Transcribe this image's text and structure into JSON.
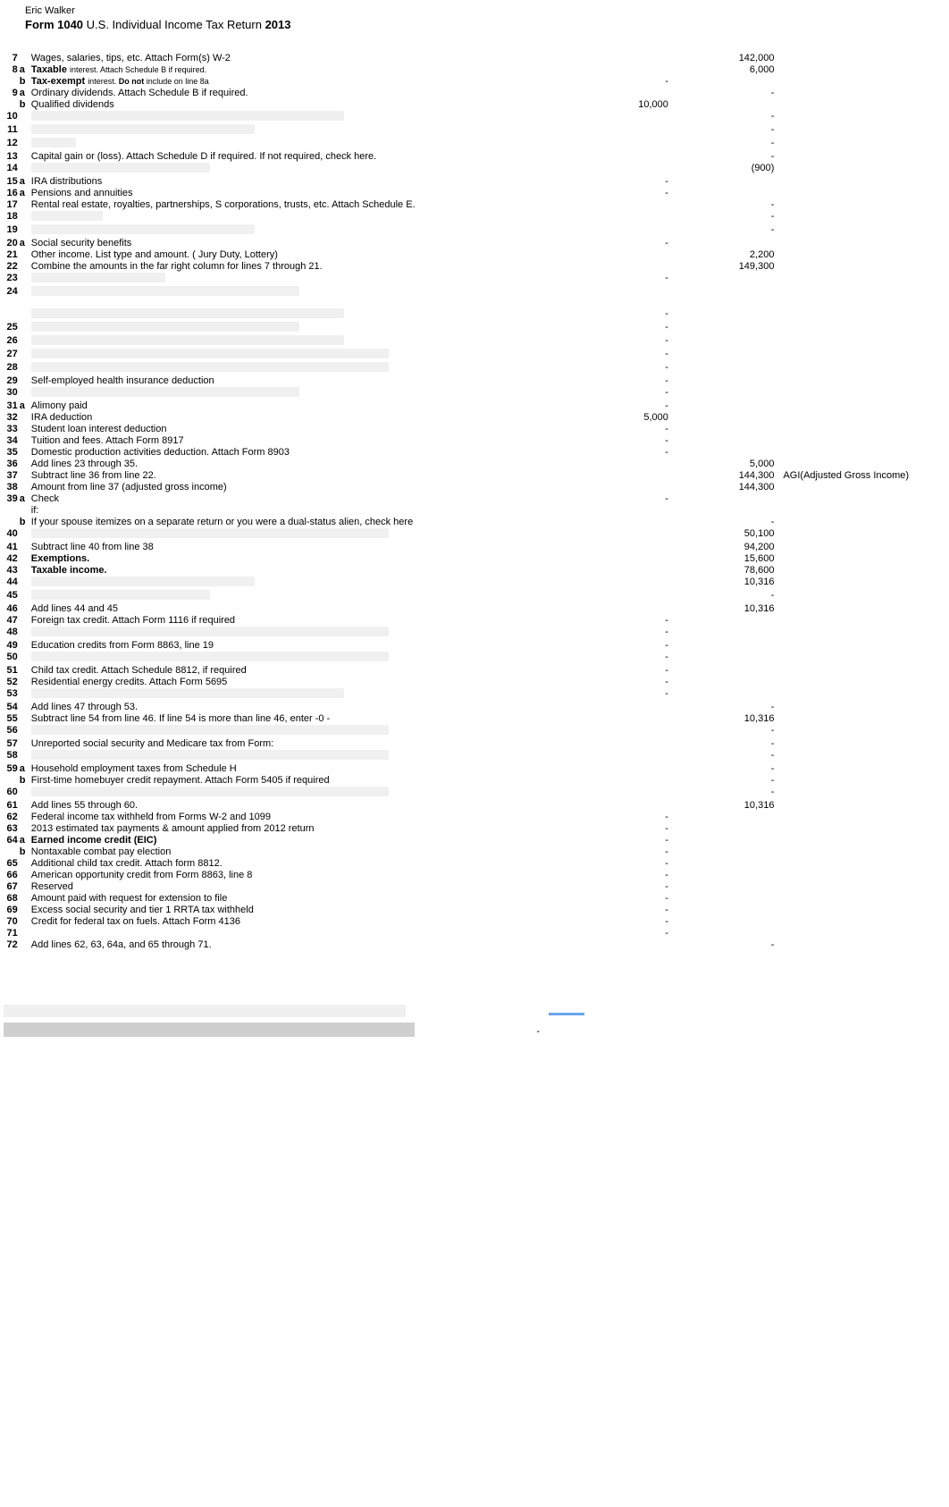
{
  "header": {
    "name": "Eric Walker",
    "form_label_bold": "Form 1040",
    "form_label_rest": " U.S. Individual Income Tax Return ",
    "year": "2013"
  },
  "lines": [
    {
      "n": "7",
      "s": "",
      "desc": "Wages, salaries, tips, etc. Attach Form(s) W-2",
      "col1": "",
      "col2": "142,000"
    },
    {
      "n": "8",
      "s": "a",
      "desc_html": "<span class='bold'>Taxable</span> <span class='sm'>interest.  Attach Schedule B if required.</span>",
      "col1": "",
      "col2": "6,000"
    },
    {
      "n": "",
      "s": "b",
      "desc_html": "<span class='bold'>Tax-exempt</span> <span class='sm'>interest.  <span class='bold'>Do not</span> include on line 8a</span>",
      "col1": "-",
      "col2": ""
    },
    {
      "n": "9",
      "s": "a",
      "desc": "Ordinary dividends.  Attach Schedule B if required.",
      "col1": "",
      "col2": "-"
    },
    {
      "n": "",
      "s": "b",
      "desc": "Qualified dividends",
      "col1": "10,000",
      "col2": ""
    },
    {
      "n": "10",
      "s": "",
      "redact": "w350",
      "col1": "",
      "col2": "-"
    },
    {
      "n": "11",
      "s": "",
      "redact": "w250",
      "col1": "",
      "col2": "-"
    },
    {
      "n": "12",
      "s": "",
      "redact": "w50",
      "col1": "",
      "col2": "-"
    },
    {
      "n": "13",
      "s": "",
      "desc": "Capital gain or (loss). Attach Schedule D if required. If not required, check here.",
      "col1": "",
      "col2": "-"
    },
    {
      "n": "14",
      "s": "",
      "redact": "w200",
      "col1": "",
      "col2": "(900)"
    },
    {
      "n": "15",
      "s": "a",
      "desc": "IRA distributions",
      "col1": "-",
      "col2": ""
    },
    {
      "n": "16",
      "s": "a",
      "desc": "Pensions and annuities",
      "col1": "-",
      "col2": ""
    },
    {
      "n": "17",
      "s": "",
      "desc": "Rental real estate, royalties, partnerships, S corporations, trusts, etc.     Attach Schedule E.",
      "col1": "",
      "col2": "-"
    },
    {
      "n": "18",
      "s": "",
      "redact": "w80",
      "col1": "",
      "col2": "-"
    },
    {
      "n": "19",
      "s": "",
      "redact": "w250",
      "col1": "",
      "col2": "-"
    },
    {
      "n": "20",
      "s": "a",
      "desc": "Social security benefits",
      "col1": "-",
      "col2": ""
    },
    {
      "n": "21",
      "s": "",
      "desc": "Other income.  List type and amount. ( Jury Duty, Lottery)",
      "col1": "",
      "col2": "2,200"
    },
    {
      "n": "22",
      "s": "",
      "desc": "Combine the amounts in the far right column for lines 7 through 21.",
      "col1": "",
      "col2": "149,300"
    },
    {
      "n": "23",
      "s": "",
      "redact": "w150",
      "col1": "-",
      "col2": ""
    },
    {
      "n": "24",
      "s": "",
      "redact": "w300",
      "col1": "",
      "col2": ""
    },
    {
      "spacer": true
    },
    {
      "n": "",
      "s": "",
      "redact": "w350",
      "col1": "-",
      "col2": ""
    },
    {
      "n": "25",
      "s": "",
      "redact": "w300",
      "col1": "-",
      "col2": ""
    },
    {
      "n": "26",
      "s": "",
      "redact": "w350",
      "col1": "-",
      "col2": ""
    },
    {
      "n": "27",
      "s": "",
      "redact": "w400",
      "col1": "-",
      "col2": ""
    },
    {
      "n": "28",
      "s": "",
      "redact": "w400",
      "col1": "-",
      "col2": ""
    },
    {
      "n": "29",
      "s": "",
      "desc": "Self-employed health insurance deduction",
      "col1": "-",
      "col2": ""
    },
    {
      "n": "30",
      "s": "",
      "redact": "w300",
      "col1": "-",
      "col2": ""
    },
    {
      "n": "31",
      "s": "a",
      "desc": "Alimony paid",
      "col1": "-",
      "col2": ""
    },
    {
      "n": "32",
      "s": "",
      "desc": "IRA deduction",
      "col1": "5,000",
      "col2": ""
    },
    {
      "n": "33",
      "s": "",
      "desc": "Student loan interest deduction",
      "col1": "-",
      "col2": ""
    },
    {
      "n": "34",
      "s": "",
      "desc": "Tuition and fees. Attach Form 8917",
      "col1": "-",
      "col2": ""
    },
    {
      "n": "35",
      "s": "",
      "desc": "Domestic production activities deduction.  Attach Form 8903",
      "col1": "-",
      "col2": ""
    },
    {
      "n": "36",
      "s": "",
      "desc": "Add lines  23  through 35.",
      "col1": "",
      "col2": "5,000"
    },
    {
      "n": "37",
      "s": "",
      "desc": "Subtract line 36 from line 22.",
      "col1": "",
      "col2": "144,300",
      "side": "AGI(Adjusted Gross Income)"
    },
    {
      "n": "38",
      "s": "",
      "desc": "Amount from line 37 (adjusted gross income)",
      "col1": "",
      "col2": "144,300"
    },
    {
      "n": "39",
      "s": "a",
      "desc": "Check",
      "col1": "-",
      "col2": ""
    },
    {
      "n": "",
      "s": "",
      "desc": "if:",
      "col1": "",
      "col2": ""
    },
    {
      "n": "",
      "s": "b",
      "desc": "If your spouse itemizes on a separate return or you were a dual-status alien, check here",
      "col1": "",
      "col2": "-"
    },
    {
      "n": "40",
      "s": "",
      "redact": "w400",
      "col1": "",
      "col2": "50,100"
    },
    {
      "n": "41",
      "s": "",
      "desc": "Subtract line 40 from line 38",
      "col1": "",
      "col2": "94,200"
    },
    {
      "n": "42",
      "s": "",
      "desc_html": "<span class='bold'>Exemptions.</span>",
      "col1": "",
      "col2": "15,600"
    },
    {
      "n": "43",
      "s": "",
      "desc_html": "<span class='bold'>Taxable income.</span>",
      "col1": "",
      "col2": "78,600"
    },
    {
      "n": "44",
      "s": "",
      "redact": "w250",
      "col1": "",
      "col2": "10,316"
    },
    {
      "n": "45",
      "s": "",
      "redact": "w200",
      "col1": "",
      "col2": "-"
    },
    {
      "n": "46",
      "s": "",
      "desc": "Add lines 44 and 45",
      "col1": "",
      "col2": "10,316"
    },
    {
      "n": "47",
      "s": "",
      "desc": "Foreign tax credit.  Attach Form 1116 if required",
      "col1": "-",
      "col2": ""
    },
    {
      "n": "48",
      "s": "",
      "redact": "w400",
      "col1": "-",
      "col2": ""
    },
    {
      "n": "49",
      "s": "",
      "desc": "Education credits from Form 8863, line 19",
      "col1": "-",
      "col2": ""
    },
    {
      "n": "50",
      "s": "",
      "redact": "w400",
      "col1": "-",
      "col2": ""
    },
    {
      "n": "51",
      "s": "",
      "desc": "Child tax credit. Attach Schedule 8812, if required",
      "col1": "-",
      "col2": ""
    },
    {
      "n": "52",
      "s": "",
      "desc": "Residential energy credits.  Attach Form 5695",
      "col1": "-",
      "col2": ""
    },
    {
      "n": "53",
      "s": "",
      "redact": "w350",
      "col1": "-",
      "col2": ""
    },
    {
      "n": "54",
      "s": "",
      "desc": "Add lines 47 through 53.",
      "col1": "",
      "col2": "-"
    },
    {
      "n": "55",
      "s": "",
      "desc": "Subtract line 54 from line 46. If line 54 is more than line 46, enter -0 -",
      "col1": "",
      "col2": "10,316"
    },
    {
      "n": "56",
      "s": "",
      "redact": "w400",
      "col1": "",
      "col2": "-"
    },
    {
      "n": "57",
      "s": "",
      "desc": "Unreported social security and Medicare tax from Form:",
      "col1": "",
      "col2": "-"
    },
    {
      "n": "58",
      "s": "",
      "redact": "w400",
      "col1": "",
      "col2": "-"
    },
    {
      "n": "59",
      "s": "a",
      "desc": "Household employment taxes from Schedule H",
      "col1": "",
      "col2": "-"
    },
    {
      "n": "",
      "s": "b",
      "desc": "First-time homebuyer credit repayment. Attach Form 5405 if required",
      "col1": "",
      "col2": "-"
    },
    {
      "n": "60",
      "s": "",
      "redact": "w400",
      "col1": "",
      "col2": "-"
    },
    {
      "n": "61",
      "s": "",
      "desc": "Add lines 55 through 60.",
      "col1": "",
      "col2": "10,316"
    },
    {
      "n": "62",
      "s": "",
      "desc": "Federal income tax withheld from Forms W-2 and 1099",
      "col1": "-",
      "col2": ""
    },
    {
      "n": "63",
      "s": "",
      "desc": "2013 estimated tax payments  &  amount applied from 2012 return",
      "col1": "-",
      "col2": ""
    },
    {
      "n": "64",
      "s": "a",
      "desc_html": "<span class='bold'>Earned income credit (EIC)</span>",
      "col1": "-",
      "col2": ""
    },
    {
      "n": "",
      "s": "b",
      "desc": "Nontaxable combat pay election",
      "col1": "-",
      "col2": ""
    },
    {
      "n": "65",
      "s": "",
      "desc": "Additional child tax credit.   Attach form 8812.",
      "col1": "-",
      "col2": ""
    },
    {
      "n": "66",
      "s": "",
      "desc": "American opportunity credit from Form 8863, line 8",
      "col1": "-",
      "col2": ""
    },
    {
      "n": "67",
      "s": "",
      "desc": "Reserved",
      "col1": "-",
      "col2": ""
    },
    {
      "n": "68",
      "s": "",
      "desc": "Amount paid with request for extension to file",
      "col1": "-",
      "col2": ""
    },
    {
      "n": "69",
      "s": "",
      "desc": "Excess social security and tier 1 RRTA tax withheld",
      "col1": "-",
      "col2": ""
    },
    {
      "n": "70",
      "s": "",
      "desc": "Credit for federal tax on fuels. Attach Form 4136",
      "col1": "-",
      "col2": ""
    },
    {
      "n": "71",
      "s": "",
      "desc": "",
      "col1": "-",
      "col2": ""
    },
    {
      "n": "72",
      "s": "",
      "desc": "Add lines 62, 63, 64a, and 65 through 71.",
      "col1": "",
      "col2": "-"
    }
  ],
  "footer": {
    "dash": "-"
  }
}
